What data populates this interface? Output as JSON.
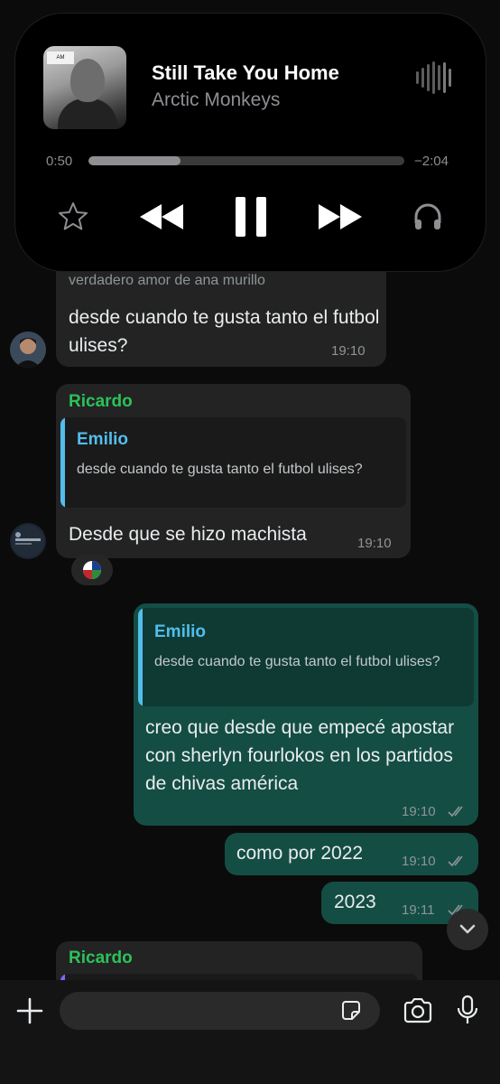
{
  "now_playing": {
    "title": "Still Take You Home",
    "artist": "Arctic Monkeys",
    "elapsed": "0:50",
    "remaining": "−2:04",
    "progress": 0.29
  },
  "messages": {
    "partial_top": {
      "preview": "verdadero amor de ana murillo",
      "text": "desde cuando te gusta tanto el futbol ulises?",
      "time": "19:10"
    },
    "ricardo_1": {
      "sender": "Ricardo",
      "quote_name": "Emilio",
      "quote_text": "desde cuando te gusta tanto el futbol ulises?",
      "text": "Desde que se hizo machista",
      "time": "19:10"
    },
    "out_1": {
      "quote_name": "Emilio",
      "quote_text": "desde cuando te gusta tanto el futbol ulises?",
      "text": "creo que desde que empecé apostar con sherlyn fourlokos en los partidos de chivas américa",
      "time": "19:10"
    },
    "out_2": {
      "text": "como por 2022",
      "time": "19:10"
    },
    "out_3": {
      "text": "2023",
      "time": "19:11"
    },
    "ricardo_2": {
      "sender": "Ricardo"
    }
  },
  "colors": {
    "sender_green": "#2bc25a",
    "quote_blue": "#53bdeb",
    "outgoing_bubble": "#144d44",
    "incoming_bubble": "#232323"
  }
}
